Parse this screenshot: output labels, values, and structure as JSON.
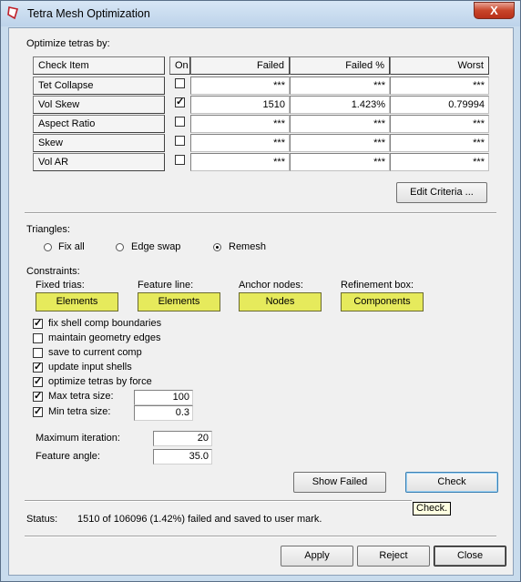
{
  "window": {
    "title": "Tetra Mesh Optimization",
    "close_symbol": "X"
  },
  "optimize": {
    "heading": "Optimize tetras by:",
    "columns": [
      "Check Item",
      "On",
      "Failed",
      "Failed %",
      "Worst"
    ],
    "rows": [
      {
        "item": "Tet Collapse",
        "on": false,
        "failed": "***",
        "failed_pct": "***",
        "worst": "***"
      },
      {
        "item": "Vol Skew",
        "on": true,
        "failed": "1510",
        "failed_pct": "1.423%",
        "worst": "0.79994"
      },
      {
        "item": "Aspect Ratio",
        "on": false,
        "failed": "***",
        "failed_pct": "***",
        "worst": "***"
      },
      {
        "item": "Skew",
        "on": false,
        "failed": "***",
        "failed_pct": "***",
        "worst": "***"
      },
      {
        "item": "Vol AR",
        "on": false,
        "failed": "***",
        "failed_pct": "***",
        "worst": "***"
      }
    ],
    "edit_criteria_label": "Edit Criteria ..."
  },
  "triangles": {
    "heading": "Triangles:",
    "options": [
      "Fix all",
      "Edge swap",
      "Remesh"
    ],
    "selected": "Remesh"
  },
  "constraints": {
    "heading": "Constraints:",
    "selectors": [
      {
        "label": "Fixed trias:",
        "button": "Elements"
      },
      {
        "label": "Feature line:",
        "button": "Elements"
      },
      {
        "label": "Anchor nodes:",
        "button": "Nodes"
      },
      {
        "label": "Refinement box:",
        "button": "Components"
      }
    ],
    "checkboxes": [
      {
        "label": "fix shell comp boundaries",
        "checked": true
      },
      {
        "label": "maintain geometry edges",
        "checked": false
      },
      {
        "label": "save to current comp",
        "checked": false
      },
      {
        "label": "update input shells",
        "checked": true
      },
      {
        "label": "optimize tetras by force",
        "checked": true
      },
      {
        "label": "Max tetra size:",
        "checked": true,
        "value": "100"
      },
      {
        "label": "Min tetra size:",
        "checked": true,
        "value": "0.3"
      }
    ]
  },
  "params": {
    "max_iteration_label": "Maximum iteration:",
    "max_iteration_value": "20",
    "feature_angle_label": "Feature angle:",
    "feature_angle_value": "35.0"
  },
  "actions": {
    "show_failed": "Show Failed",
    "check": "Check",
    "tooltip": "Check."
  },
  "status": {
    "label": "Status:",
    "text": "1510 of 106096 (1.42%) failed and saved to user mark."
  },
  "footer": {
    "apply": "Apply",
    "reject": "Reject",
    "close": "Close"
  },
  "colors": {
    "constraint_button": "#e6ea5c",
    "close_button": "#c8452a"
  }
}
